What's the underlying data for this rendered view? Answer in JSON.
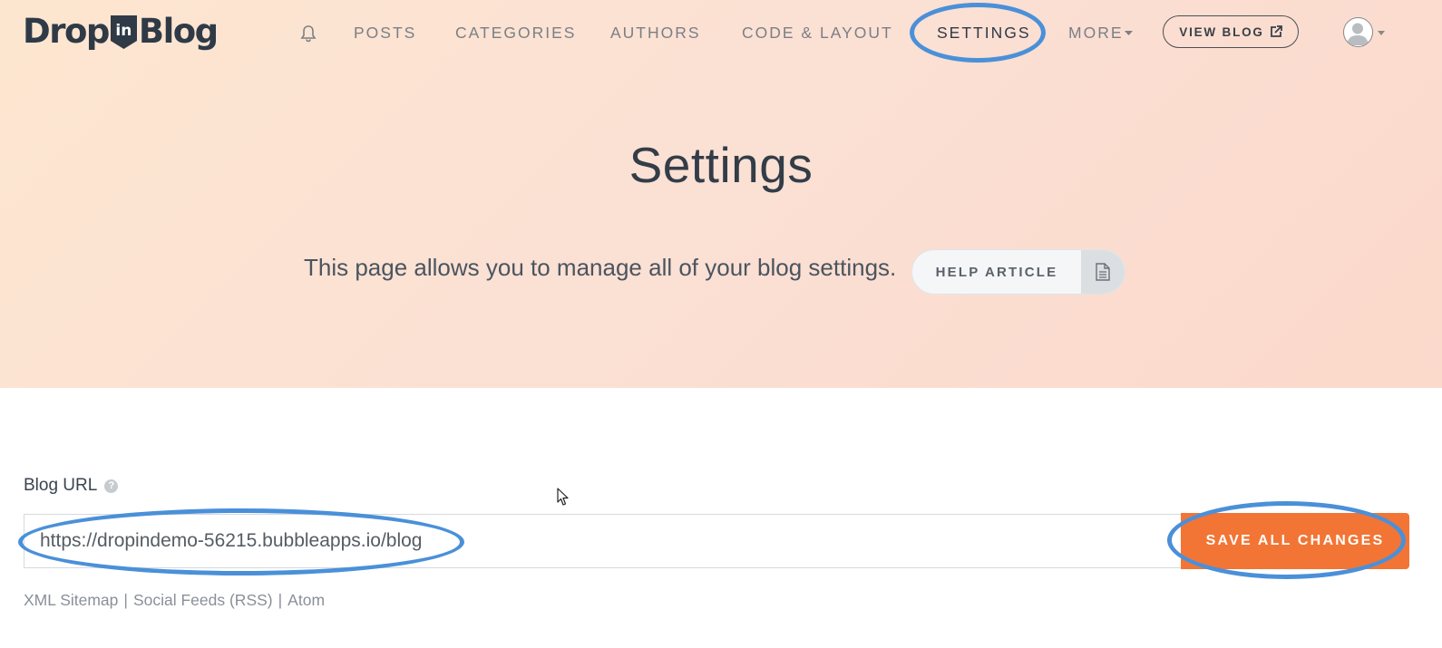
{
  "brand": {
    "logo_left": "Drop",
    "logo_badge": "in",
    "logo_right": "Blog"
  },
  "nav": {
    "bell_icon": "bell-icon",
    "items": [
      {
        "label": "POSTS"
      },
      {
        "label": "CATEGORIES"
      },
      {
        "label": "AUTHORS"
      },
      {
        "label": "CODE & LAYOUT"
      },
      {
        "label": "SETTINGS",
        "active": true
      },
      {
        "label": "MORE"
      }
    ],
    "view_blog_label": "VIEW BLOG",
    "user_menu": "avatar-icon"
  },
  "hero": {
    "title": "Settings",
    "description": "This page allows you to manage all of your blog settings.",
    "help_label": "HELP ARTICLE",
    "help_icon": "document-icon"
  },
  "form": {
    "blog_url_label": "Blog URL",
    "blog_url_value": "https://dropindemo-56215.bubbleapps.io/blog",
    "save_label": "SAVE ALL CHANGES"
  },
  "feed_links": {
    "sitemap": "XML Sitemap",
    "sep1": "|",
    "rss": "Social Feeds (RSS)",
    "sep2": "|",
    "atom": "Atom"
  },
  "colors": {
    "accent": "#f27535",
    "annotation_ring": "#4a90d9",
    "hero_bg": "#fbe0d4"
  }
}
